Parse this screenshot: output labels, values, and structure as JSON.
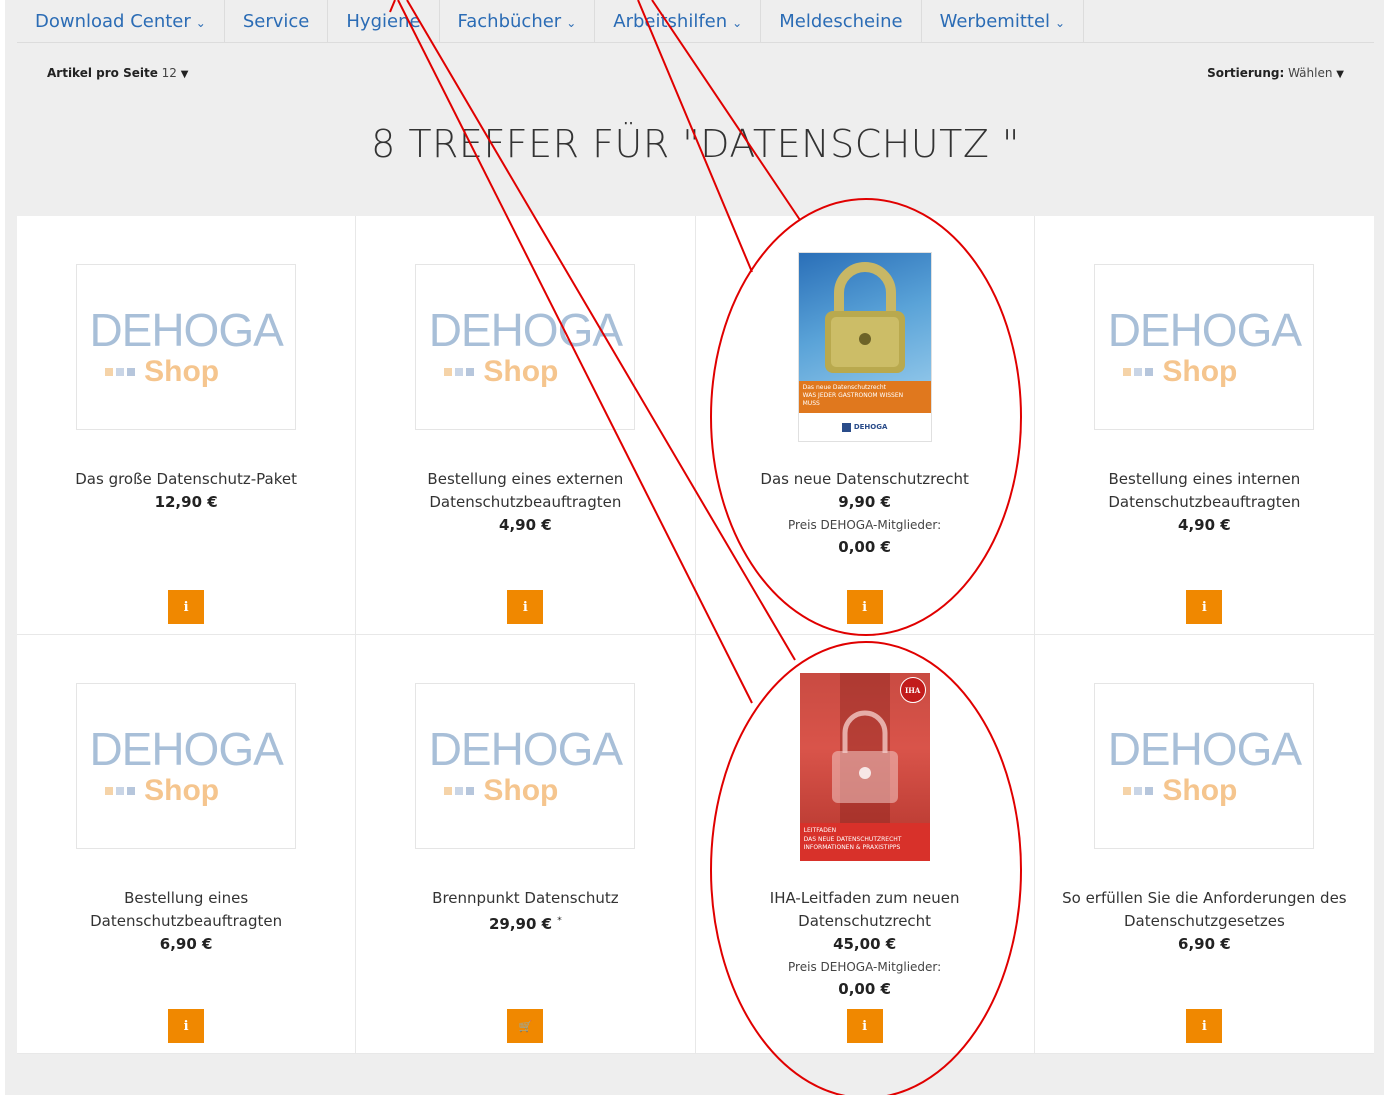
{
  "nav": [
    {
      "label": "Download Center",
      "dropdown": true
    },
    {
      "label": "Service",
      "dropdown": false
    },
    {
      "label": "Hygiene",
      "dropdown": false
    },
    {
      "label": "Fachbücher",
      "dropdown": true
    },
    {
      "label": "Arbeitshilfen",
      "dropdown": true
    },
    {
      "label": "Meldescheine",
      "dropdown": false
    },
    {
      "label": "Werbemittel",
      "dropdown": true
    }
  ],
  "toolbar": {
    "per_page_label": "Artikel pro Seite",
    "per_page_value": "12",
    "sort_label": "Sortierung:",
    "sort_value": "Wählen"
  },
  "results_title": "8 TREFFER FÜR \"DATENSCHUTZ \"",
  "placeholder_logo": {
    "top": "DEHOGA",
    "bottom": "Shop"
  },
  "colors": {
    "accent_button": "#f08800",
    "nav_link": "#2b6cb5",
    "annotation_red": "#e00000"
  },
  "products": [
    {
      "name": "Das große Datenschutz-Paket",
      "price": "12,90 €",
      "image": "placeholder",
      "button": "info-icon"
    },
    {
      "name": "Bestellung eines externen Datenschutzbeauftragten",
      "price": "4,90 €",
      "image": "placeholder",
      "button": "info-icon"
    },
    {
      "name": "Das neue Datenschutzrecht",
      "price": "9,90 €",
      "member_label": "Preis DEHOGA-Mitglieder:",
      "member_price": "0,00 €",
      "image": "cover-lock",
      "button": "info-icon"
    },
    {
      "name": "Bestellung eines internen Datenschutzbeauftragten",
      "price": "4,90 €",
      "image": "placeholder",
      "button": "info-icon"
    },
    {
      "name": "Bestellung eines Datenschutzbeauftragten",
      "price": "6,90 €",
      "image": "placeholder",
      "button": "info-icon"
    },
    {
      "name": "Brennpunkt Datenschutz",
      "price": "29,90 €",
      "price_note": "*",
      "image": "placeholder",
      "button": "cart-icon"
    },
    {
      "name": "IHA-Leitfaden zum neuen Datenschutzrecht",
      "price": "45,00 €",
      "member_label": "Preis DEHOGA-Mitglieder:",
      "member_price": "0,00 €",
      "image": "cover-iha",
      "button": "info-icon"
    },
    {
      "name": "So erfüllen Sie die Anforderungen des Datenschutzgesetzes",
      "price": "6,90 €",
      "image": "placeholder",
      "button": "info-icon"
    }
  ],
  "cover_lock": {
    "band_line1": "Das neue Datenschutzrecht",
    "band_line2": "WAS JEDER GASTRONOM WISSEN",
    "band_line3": "MUSS",
    "publisher": "DEHOGA"
  },
  "cover_iha": {
    "badge": "IHA",
    "band_line1": "LEITFADEN",
    "band_line2": "DAS NEUE DATENSCHUTZRECHT",
    "band_line3": "INFORMATIONEN & PRAXISTIPPS"
  }
}
